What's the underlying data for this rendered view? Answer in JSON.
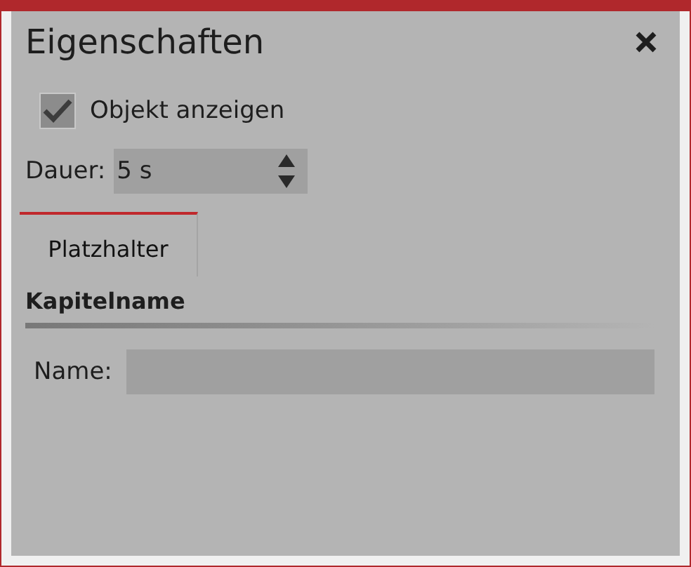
{
  "window": {
    "title": "Eigenschaften"
  },
  "show_object": {
    "label": "Objekt anzeigen",
    "checked": true
  },
  "duration": {
    "label": "Dauer:",
    "value": "5 s"
  },
  "tabs": [
    {
      "label": "Platzhalter",
      "selected": true
    }
  ],
  "section": {
    "title": "Kapitelname"
  },
  "fields": [
    {
      "label": "Name:"
    }
  ]
}
